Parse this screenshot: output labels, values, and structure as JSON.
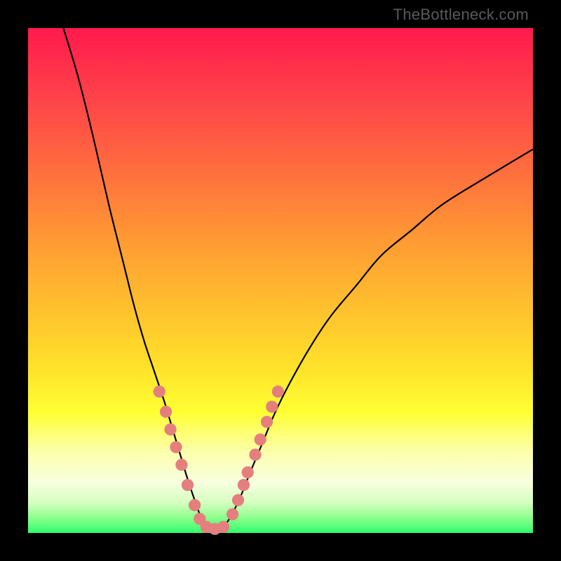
{
  "watermark": "TheBottleneck.com",
  "chart_data": {
    "type": "line",
    "title": "",
    "xlabel": "",
    "ylabel": "",
    "ylim": [
      0,
      100
    ],
    "xlim": [
      0,
      100
    ],
    "series": [
      {
        "name": "left-curve",
        "x": [
          7,
          10,
          13,
          16,
          19,
          21,
          23,
          25,
          27,
          28.5,
          30,
          31.5,
          33,
          34.3,
          35.5
        ],
        "values": [
          100,
          90,
          78,
          65,
          53,
          45,
          38,
          32,
          26,
          21,
          16,
          11,
          6.5,
          3,
          1
        ]
      },
      {
        "name": "right-curve",
        "x": [
          38.5,
          40,
          42,
          44,
          46.5,
          49,
          52,
          56,
          60,
          65,
          70,
          76,
          82,
          90,
          100
        ],
        "values": [
          1,
          3,
          7,
          12,
          18,
          24,
          30,
          37,
          43,
          49,
          55,
          60,
          65,
          70,
          76
        ]
      }
    ],
    "markers": [
      {
        "x": 26.0,
        "y": 28.0
      },
      {
        "x": 27.3,
        "y": 24.0
      },
      {
        "x": 28.2,
        "y": 20.5
      },
      {
        "x": 29.3,
        "y": 17.0
      },
      {
        "x": 30.4,
        "y": 13.5
      },
      {
        "x": 31.6,
        "y": 9.5
      },
      {
        "x": 33.0,
        "y": 5.5
      },
      {
        "x": 34.0,
        "y": 2.8
      },
      {
        "x": 35.3,
        "y": 1.2
      },
      {
        "x": 37.0,
        "y": 0.8
      },
      {
        "x": 38.7,
        "y": 1.2
      },
      {
        "x": 40.5,
        "y": 3.7
      },
      {
        "x": 41.6,
        "y": 6.5
      },
      {
        "x": 42.7,
        "y": 9.5
      },
      {
        "x": 43.5,
        "y": 12.0
      },
      {
        "x": 45.0,
        "y": 15.5
      },
      {
        "x": 46.0,
        "y": 18.5
      },
      {
        "x": 47.3,
        "y": 22.0
      },
      {
        "x": 48.3,
        "y": 25.0
      },
      {
        "x": 49.5,
        "y": 28.0
      }
    ],
    "marker_color": "#e47f7e",
    "marker_radius_frac": 0.012,
    "gradient_stops": [
      {
        "pos": 0.0,
        "color": "#ff1a4d"
      },
      {
        "pos": 0.12,
        "color": "#ff3d4a"
      },
      {
        "pos": 0.27,
        "color": "#ff6a3f"
      },
      {
        "pos": 0.42,
        "color": "#ff9a33"
      },
      {
        "pos": 0.55,
        "color": "#ffbf2e"
      },
      {
        "pos": 0.67,
        "color": "#ffe12a"
      },
      {
        "pos": 0.76,
        "color": "#ffff33"
      },
      {
        "pos": 0.84,
        "color": "#fcffac"
      },
      {
        "pos": 0.9,
        "color": "#f7ffe0"
      },
      {
        "pos": 0.94,
        "color": "#d5ffc0"
      },
      {
        "pos": 0.97,
        "color": "#8dff8d"
      },
      {
        "pos": 1.0,
        "color": "#2eff6e"
      }
    ]
  }
}
